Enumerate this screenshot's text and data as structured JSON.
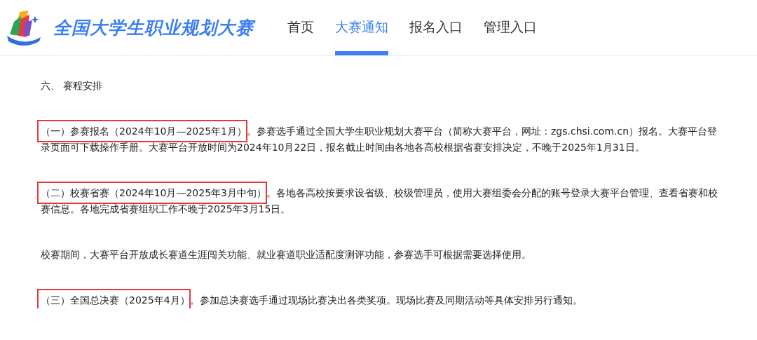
{
  "header": {
    "site_title": "全国大学生职业规划大赛",
    "nav": [
      {
        "label": "首页",
        "selected": false
      },
      {
        "label": "大赛通知",
        "selected": true
      },
      {
        "label": "报名入口",
        "selected": false
      },
      {
        "label": "管理入口",
        "selected": false
      }
    ]
  },
  "article": {
    "heading": "六、 赛程安排",
    "paragraphs": [
      {
        "lead": "（一）参赛报名（2024年10月—2025年1月）",
        "highlighted": true,
        "text": "。参赛选手通过全国大学生职业规划大赛平台（简称大赛平台，网址：zgs.chsi.com.cn）报名。大赛平台登录页面可下载操作手册。大赛平台开放时间为2024年10月22日，报名截止时间由各地各高校根据省赛安排决定，不晚于2025年1月31日。"
      },
      {
        "lead": "（二）校赛省赛（2024年10月—2025年3月中旬）",
        "highlighted": true,
        "text": "。各地各高校按要求设省级、校级管理员，使用大赛组委会分配的账号登录大赛平台管理、查看省赛和校赛信息。各地完成省赛组织工作不晚于2025年3月15日。"
      },
      {
        "text": "校赛期间，大赛平台开放成长赛道生涯闯关功能、就业赛道职业适配度测评功能，参赛选手可根据需要选择使用。"
      },
      {
        "lead": "（三）全国总决赛（2025年4月）",
        "highlighted": true,
        "text": "。参加总决赛选手通过现场比赛决出各类奖项。现场比赛及同期活动等具体安排另行通知。"
      }
    ]
  }
}
